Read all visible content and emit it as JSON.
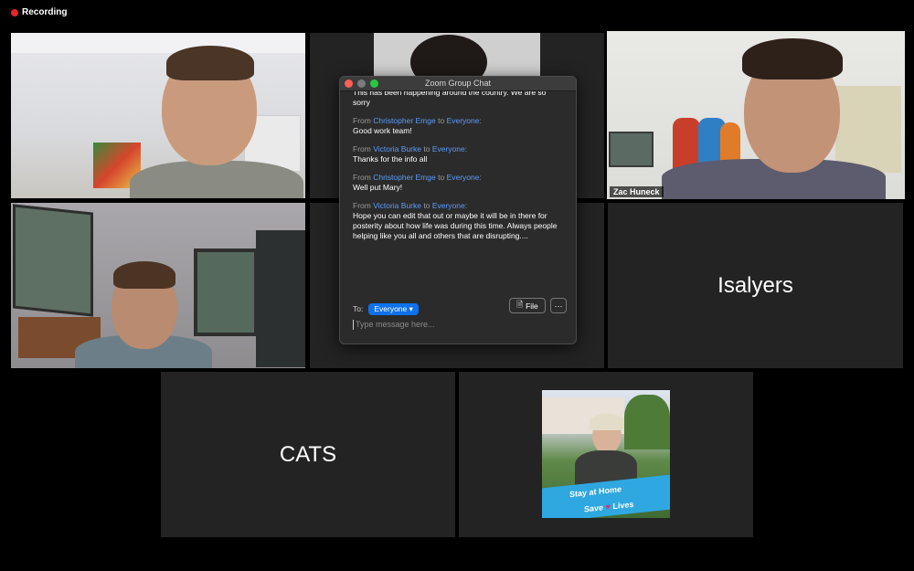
{
  "recording": {
    "label": "Recording",
    "color": "#e5252a"
  },
  "tiles": {
    "zac": {
      "name": "Zac Huneck"
    },
    "isalyers": {
      "name": "Isalyers"
    },
    "cats": {
      "name": "CATS"
    }
  },
  "chat": {
    "title": "Zoom Group Chat",
    "messages": [
      {
        "sender": "",
        "recipient": "",
        "text": "This has been happening around the country. We are so sorry"
      },
      {
        "sender": "Christopher Emge",
        "recipient": "Everyone",
        "text": "Good work team!"
      },
      {
        "sender": "Victoria Burke",
        "recipient": "Everyone",
        "text": "Thanks for the info all"
      },
      {
        "sender": "Christopher Emge",
        "recipient": "Everyone",
        "text": "Well put Mary!"
      },
      {
        "sender": "Victoria Burke",
        "recipient": "Everyone",
        "text": "Hope you can edit that out or maybe it will be in there for posterity about how life was during this time. Always people helping like you all and others that are disrupting...."
      }
    ],
    "from_word": "From",
    "to_word": "to",
    "to_label": "To:",
    "to_value": "Everyone",
    "file_label": "File",
    "more_label": "···",
    "placeholder": "Type message here..."
  },
  "poster": {
    "line1": "Stay at Home",
    "line2_a": "Save",
    "line2_b": "Lives"
  },
  "colors": {
    "accent": "#0e71eb",
    "active_speaker": "#c6e35a",
    "sender": "#5d9cf7"
  }
}
